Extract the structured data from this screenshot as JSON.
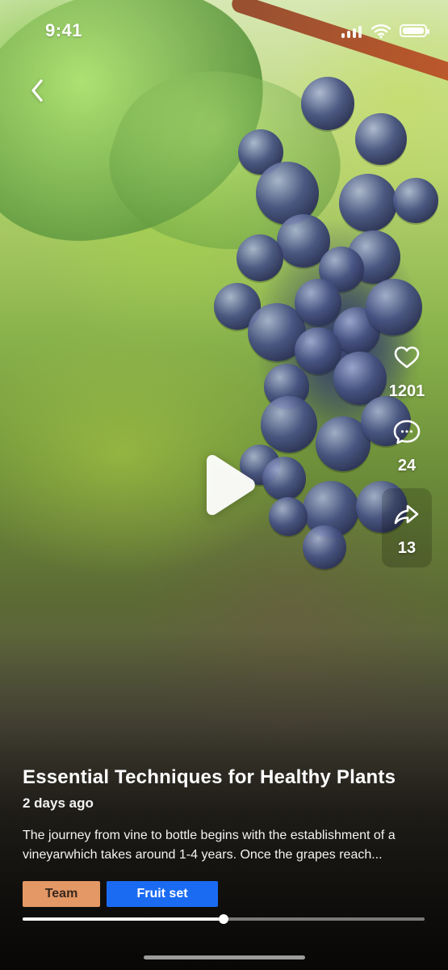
{
  "status_bar": {
    "time": "9:41",
    "icons": {
      "signal": "signal-icon",
      "wifi": "wifi-icon",
      "battery": "battery-icon"
    }
  },
  "nav": {
    "back_icon": "chevron-left-icon"
  },
  "video": {
    "play_icon": "play-icon",
    "progress": 0.5
  },
  "actions": {
    "like": {
      "icon": "heart-icon",
      "count": "1201"
    },
    "comment": {
      "icon": "chat-bubble-icon",
      "count": "24"
    },
    "share": {
      "icon": "share-arrow-icon",
      "count": "13"
    }
  },
  "post": {
    "title": "Essential Techniques for Healthy Plants",
    "time_ago": "2 days ago",
    "description": "The journey from vine to bottle begins with the establishment of a vineyarwhich takes around 1-4 years. Once the grapes reach...",
    "tags": [
      {
        "label": "Team",
        "color": "#f0a06a"
      },
      {
        "label": "Fruit set",
        "color": "#1b6bf2"
      }
    ]
  }
}
